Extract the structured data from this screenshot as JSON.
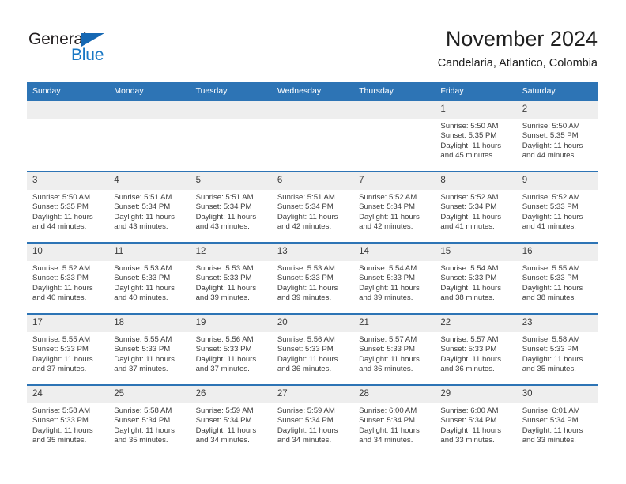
{
  "brand": {
    "name_part1": "General",
    "name_part2": "Blue",
    "accent_color": "#1877c4",
    "triangle_color": "#1668b3"
  },
  "header": {
    "title": "November 2024",
    "subtitle": "Candelaria, Atlantico, Colombia"
  },
  "calendar": {
    "header_bg": "#2d74b5",
    "daynum_bg": "#eeeeee",
    "weekdays": [
      "Sunday",
      "Monday",
      "Tuesday",
      "Wednesday",
      "Thursday",
      "Friday",
      "Saturday"
    ],
    "weeks": [
      [
        {
          "day": "",
          "empty": true
        },
        {
          "day": "",
          "empty": true
        },
        {
          "day": "",
          "empty": true
        },
        {
          "day": "",
          "empty": true
        },
        {
          "day": "",
          "empty": true
        },
        {
          "day": "1",
          "sunrise": "Sunrise: 5:50 AM",
          "sunset": "Sunset: 5:35 PM",
          "daylight": "Daylight: 11 hours and 45 minutes."
        },
        {
          "day": "2",
          "sunrise": "Sunrise: 5:50 AM",
          "sunset": "Sunset: 5:35 PM",
          "daylight": "Daylight: 11 hours and 44 minutes."
        }
      ],
      [
        {
          "day": "3",
          "sunrise": "Sunrise: 5:50 AM",
          "sunset": "Sunset: 5:35 PM",
          "daylight": "Daylight: 11 hours and 44 minutes."
        },
        {
          "day": "4",
          "sunrise": "Sunrise: 5:51 AM",
          "sunset": "Sunset: 5:34 PM",
          "daylight": "Daylight: 11 hours and 43 minutes."
        },
        {
          "day": "5",
          "sunrise": "Sunrise: 5:51 AM",
          "sunset": "Sunset: 5:34 PM",
          "daylight": "Daylight: 11 hours and 43 minutes."
        },
        {
          "day": "6",
          "sunrise": "Sunrise: 5:51 AM",
          "sunset": "Sunset: 5:34 PM",
          "daylight": "Daylight: 11 hours and 42 minutes."
        },
        {
          "day": "7",
          "sunrise": "Sunrise: 5:52 AM",
          "sunset": "Sunset: 5:34 PM",
          "daylight": "Daylight: 11 hours and 42 minutes."
        },
        {
          "day": "8",
          "sunrise": "Sunrise: 5:52 AM",
          "sunset": "Sunset: 5:34 PM",
          "daylight": "Daylight: 11 hours and 41 minutes."
        },
        {
          "day": "9",
          "sunrise": "Sunrise: 5:52 AM",
          "sunset": "Sunset: 5:33 PM",
          "daylight": "Daylight: 11 hours and 41 minutes."
        }
      ],
      [
        {
          "day": "10",
          "sunrise": "Sunrise: 5:52 AM",
          "sunset": "Sunset: 5:33 PM",
          "daylight": "Daylight: 11 hours and 40 minutes."
        },
        {
          "day": "11",
          "sunrise": "Sunrise: 5:53 AM",
          "sunset": "Sunset: 5:33 PM",
          "daylight": "Daylight: 11 hours and 40 minutes."
        },
        {
          "day": "12",
          "sunrise": "Sunrise: 5:53 AM",
          "sunset": "Sunset: 5:33 PM",
          "daylight": "Daylight: 11 hours and 39 minutes."
        },
        {
          "day": "13",
          "sunrise": "Sunrise: 5:53 AM",
          "sunset": "Sunset: 5:33 PM",
          "daylight": "Daylight: 11 hours and 39 minutes."
        },
        {
          "day": "14",
          "sunrise": "Sunrise: 5:54 AM",
          "sunset": "Sunset: 5:33 PM",
          "daylight": "Daylight: 11 hours and 39 minutes."
        },
        {
          "day": "15",
          "sunrise": "Sunrise: 5:54 AM",
          "sunset": "Sunset: 5:33 PM",
          "daylight": "Daylight: 11 hours and 38 minutes."
        },
        {
          "day": "16",
          "sunrise": "Sunrise: 5:55 AM",
          "sunset": "Sunset: 5:33 PM",
          "daylight": "Daylight: 11 hours and 38 minutes."
        }
      ],
      [
        {
          "day": "17",
          "sunrise": "Sunrise: 5:55 AM",
          "sunset": "Sunset: 5:33 PM",
          "daylight": "Daylight: 11 hours and 37 minutes."
        },
        {
          "day": "18",
          "sunrise": "Sunrise: 5:55 AM",
          "sunset": "Sunset: 5:33 PM",
          "daylight": "Daylight: 11 hours and 37 minutes."
        },
        {
          "day": "19",
          "sunrise": "Sunrise: 5:56 AM",
          "sunset": "Sunset: 5:33 PM",
          "daylight": "Daylight: 11 hours and 37 minutes."
        },
        {
          "day": "20",
          "sunrise": "Sunrise: 5:56 AM",
          "sunset": "Sunset: 5:33 PM",
          "daylight": "Daylight: 11 hours and 36 minutes."
        },
        {
          "day": "21",
          "sunrise": "Sunrise: 5:57 AM",
          "sunset": "Sunset: 5:33 PM",
          "daylight": "Daylight: 11 hours and 36 minutes."
        },
        {
          "day": "22",
          "sunrise": "Sunrise: 5:57 AM",
          "sunset": "Sunset: 5:33 PM",
          "daylight": "Daylight: 11 hours and 36 minutes."
        },
        {
          "day": "23",
          "sunrise": "Sunrise: 5:58 AM",
          "sunset": "Sunset: 5:33 PM",
          "daylight": "Daylight: 11 hours and 35 minutes."
        }
      ],
      [
        {
          "day": "24",
          "sunrise": "Sunrise: 5:58 AM",
          "sunset": "Sunset: 5:33 PM",
          "daylight": "Daylight: 11 hours and 35 minutes."
        },
        {
          "day": "25",
          "sunrise": "Sunrise: 5:58 AM",
          "sunset": "Sunset: 5:34 PM",
          "daylight": "Daylight: 11 hours and 35 minutes."
        },
        {
          "day": "26",
          "sunrise": "Sunrise: 5:59 AM",
          "sunset": "Sunset: 5:34 PM",
          "daylight": "Daylight: 11 hours and 34 minutes."
        },
        {
          "day": "27",
          "sunrise": "Sunrise: 5:59 AM",
          "sunset": "Sunset: 5:34 PM",
          "daylight": "Daylight: 11 hours and 34 minutes."
        },
        {
          "day": "28",
          "sunrise": "Sunrise: 6:00 AM",
          "sunset": "Sunset: 5:34 PM",
          "daylight": "Daylight: 11 hours and 34 minutes."
        },
        {
          "day": "29",
          "sunrise": "Sunrise: 6:00 AM",
          "sunset": "Sunset: 5:34 PM",
          "daylight": "Daylight: 11 hours and 33 minutes."
        },
        {
          "day": "30",
          "sunrise": "Sunrise: 6:01 AM",
          "sunset": "Sunset: 5:34 PM",
          "daylight": "Daylight: 11 hours and 33 minutes."
        }
      ]
    ]
  }
}
